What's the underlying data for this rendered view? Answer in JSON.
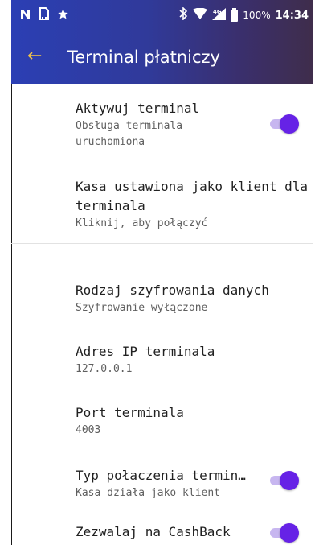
{
  "status_bar": {
    "icons_left": [
      "nfc-icon",
      "sim-card-icon",
      "star-icon"
    ],
    "icons_right": [
      "bluetooth-icon",
      "wifi-icon",
      "signal-4g-icon",
      "battery-icon"
    ],
    "battery": "100%",
    "time": "14:34"
  },
  "app_bar": {
    "title": "Terminal płatniczy",
    "back_icon": "arrow-left-icon"
  },
  "settings": [
    {
      "title": "Aktywuj terminal",
      "subtitle": "Obsługa terminala uruchomiona",
      "toggle": true
    },
    {
      "title": "Kasa ustawiona jako klient dla terminala",
      "subtitle": "Kliknij, aby połączyć",
      "toggle": null
    },
    {
      "title": "Rodzaj szyfrowania danych",
      "subtitle": "Szyfrowanie wyłączone",
      "toggle": null
    },
    {
      "title": "Adres IP terminala",
      "subtitle": "127.0.0.1",
      "toggle": null
    },
    {
      "title": "Port terminala",
      "subtitle": "4003",
      "toggle": null
    },
    {
      "title": "Typ połaczenia termin…",
      "subtitle": "Kasa działa jako klient",
      "toggle": true
    },
    {
      "title": "Zezwalaj na CashBack",
      "subtitle": "",
      "toggle": true
    }
  ],
  "colors": {
    "accent": "#6622e6",
    "toggle_track": "#c7b6f0",
    "app_bar_start": "#2b3fb4",
    "app_bar_end": "#3f2d4b",
    "back_arrow": "#f0c24a"
  }
}
